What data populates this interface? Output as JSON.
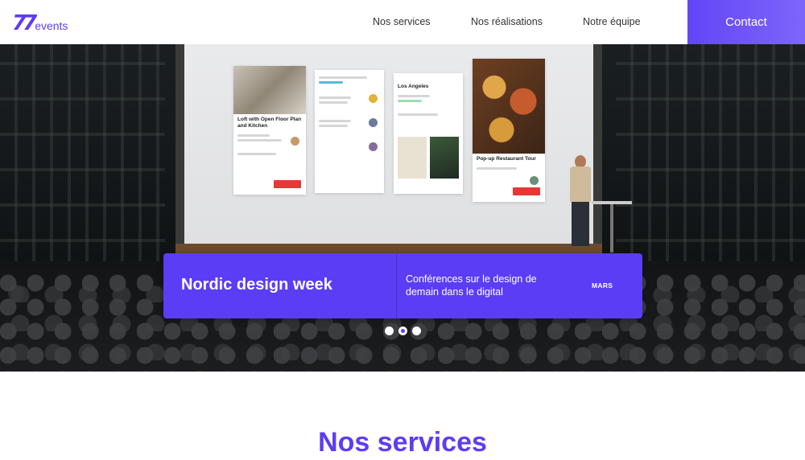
{
  "header": {
    "logo": {
      "mark": "77",
      "word": "events"
    },
    "nav": [
      {
        "label": "Nos services"
      },
      {
        "label": "Nos réalisations"
      },
      {
        "label": "Notre équipe"
      }
    ],
    "contact_label": "Contact"
  },
  "hero": {
    "screen_cards": {
      "card1_title": "Loft with Open Floor Plan and Kitchen",
      "card3_title": "Los Angeles",
      "card4_title": "Pop-up Restaurant Tour"
    },
    "event": {
      "title": "Nordic design week",
      "description": "Conférences sur le design de demain dans le digital",
      "month": "MARS"
    },
    "carousel": {
      "count": 3,
      "active_index": 1
    }
  },
  "section": {
    "title": "Nos services"
  },
  "colors": {
    "accent": "#5b3df5",
    "accent_light": "#7d65fb"
  }
}
